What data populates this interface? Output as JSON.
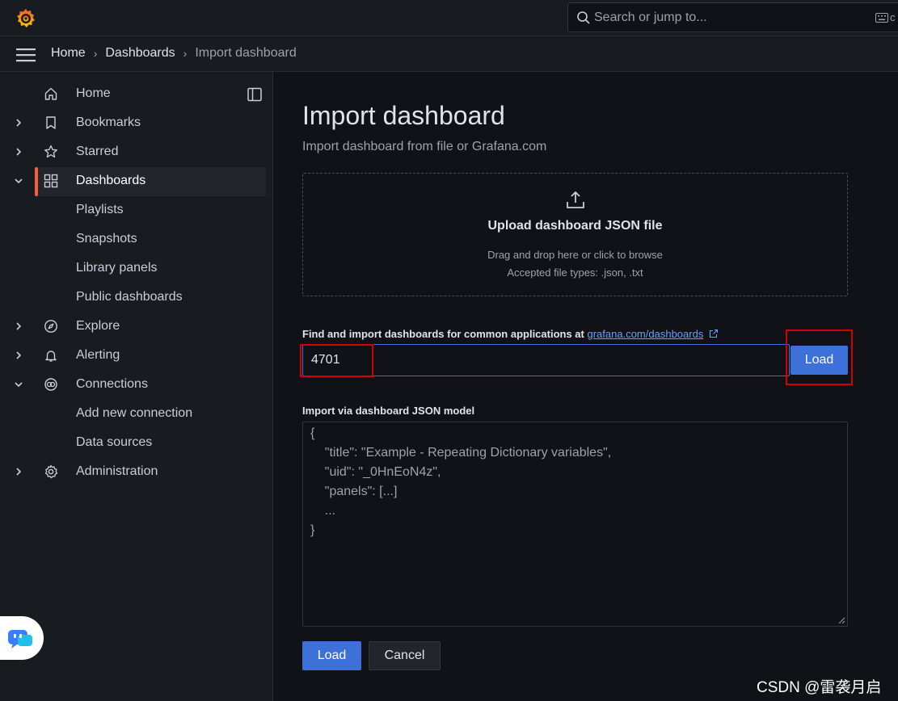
{
  "topbar": {
    "logo": "grafana-logo",
    "search_placeholder": "Search or jump to...",
    "shortcut_hint": "c"
  },
  "breadcrumb": {
    "items": [
      "Home",
      "Dashboards",
      "Import dashboard"
    ],
    "separator": "›"
  },
  "sidebar": {
    "items": [
      {
        "label": "Home",
        "icon": "home-icon"
      },
      {
        "label": "Bookmarks",
        "icon": "bookmark-icon"
      },
      {
        "label": "Starred",
        "icon": "star-icon"
      },
      {
        "label": "Dashboards",
        "icon": "apps-icon",
        "active": true
      },
      {
        "label": "Playlists"
      },
      {
        "label": "Snapshots"
      },
      {
        "label": "Library panels"
      },
      {
        "label": "Public dashboards"
      },
      {
        "label": "Explore",
        "icon": "compass-icon"
      },
      {
        "label": "Alerting",
        "icon": "bell-icon"
      },
      {
        "label": "Connections",
        "icon": "connections-icon"
      },
      {
        "label": "Add new connection"
      },
      {
        "label": "Data sources"
      },
      {
        "label": "Administration",
        "icon": "cog-icon"
      }
    ]
  },
  "main": {
    "title": "Import dashboard",
    "subtitle": "Import dashboard from file or Grafana.com",
    "upload": {
      "title": "Upload dashboard JSON file",
      "hint": "Drag and drop here or click to browse",
      "accepted": "Accepted file types: .json, .txt"
    },
    "find_label": "Find and import dashboards for common applications at",
    "find_link": "grafana.com/dashboards",
    "dashboard_id_value": "4701",
    "load_label": "Load",
    "json_label": "Import via dashboard JSON model",
    "json_placeholder_lines": [
      "{",
      "    \"title\": \"Example - Repeating Dictionary variables\",",
      "    \"uid\": \"_0HnEoN4z\",",
      "    \"panels\": [...]",
      "    ...",
      "}"
    ],
    "submit_label": "Load",
    "cancel_label": "Cancel"
  },
  "colors": {
    "accent": "#3d71d9",
    "active_bar": "#f55f3e",
    "highlight": "#d20000"
  },
  "watermark": "CSDN @雷袭月启"
}
